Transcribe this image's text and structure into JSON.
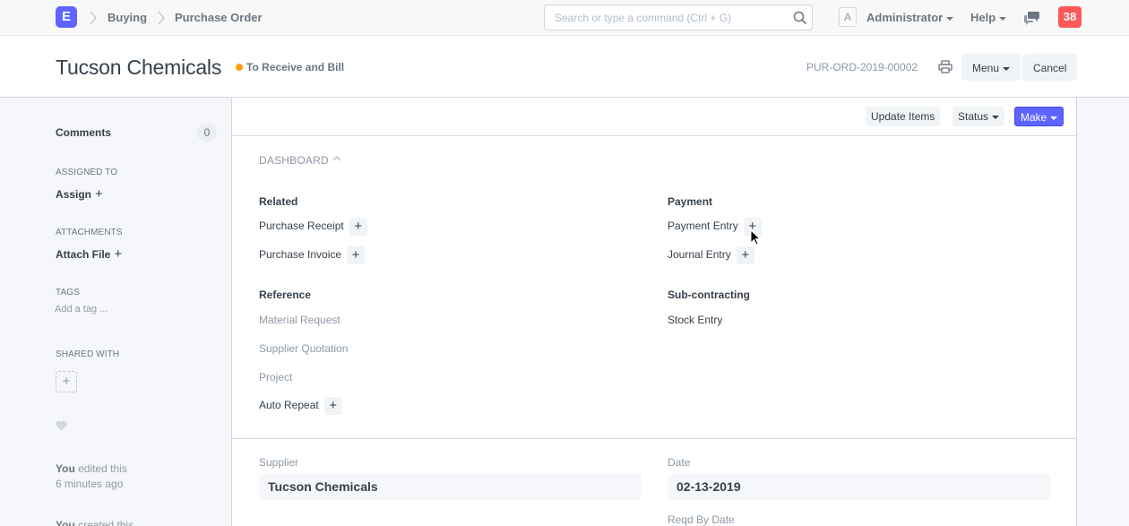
{
  "navbar": {
    "logo": "E",
    "breadcrumbs": [
      "Buying",
      "Purchase Order"
    ],
    "search_placeholder": "Search or type a command (Ctrl + G)",
    "avatar": "A",
    "user": "Administrator",
    "help": "Help",
    "notifications": "38"
  },
  "head": {
    "title": "Tucson Chemicals",
    "status": "To Receive and Bill",
    "docname": "PUR-ORD-2019-00002",
    "menu_label": "Menu",
    "cancel_label": "Cancel"
  },
  "sidebar": {
    "comments_label": "Comments",
    "comments_count": "0",
    "assigned_to_label": "Assigned To",
    "assign_action": "Assign",
    "attachments_label": "Attachments",
    "attach_action": "Attach File",
    "tags_label": "Tags",
    "tag_placeholder": "Add a tag ...",
    "shared_with_label": "Shared With",
    "activity": [
      {
        "user": "You",
        "text": "edited this",
        "time": "6 minutes ago"
      },
      {
        "user": "You",
        "text": "created this"
      }
    ]
  },
  "toolbar": {
    "update_items": "Update Items",
    "status": "Status",
    "make": "Make"
  },
  "dashboard": {
    "title": "DASHBOARD",
    "groups": [
      {
        "label": "Related",
        "items": [
          {
            "label": "Purchase Receipt",
            "addable": true
          },
          {
            "label": "Purchase Invoice",
            "addable": true
          }
        ]
      },
      {
        "label": "Payment",
        "items": [
          {
            "label": "Payment Entry",
            "addable": true
          },
          {
            "label": "Journal Entry",
            "addable": true
          }
        ]
      },
      {
        "label": "Reference",
        "items": [
          {
            "label": "Material Request",
            "addable": false
          },
          {
            "label": "Supplier Quotation",
            "addable": false
          },
          {
            "label": "Project",
            "addable": false
          },
          {
            "label": "Auto Repeat",
            "addable": true
          }
        ]
      },
      {
        "label": "Sub-contracting",
        "items": [
          {
            "label": "Stock Entry",
            "addable": false
          }
        ]
      }
    ]
  },
  "form": {
    "supplier_label": "Supplier",
    "supplier_value": "Tucson Chemicals",
    "date_label": "Date",
    "date_value": "02-13-2019",
    "reqd_by_label": "Reqd By Date"
  },
  "colors": {
    "primary": "#5e64ff",
    "status_dot": "#ffa00a",
    "notification": "#ff5858"
  }
}
